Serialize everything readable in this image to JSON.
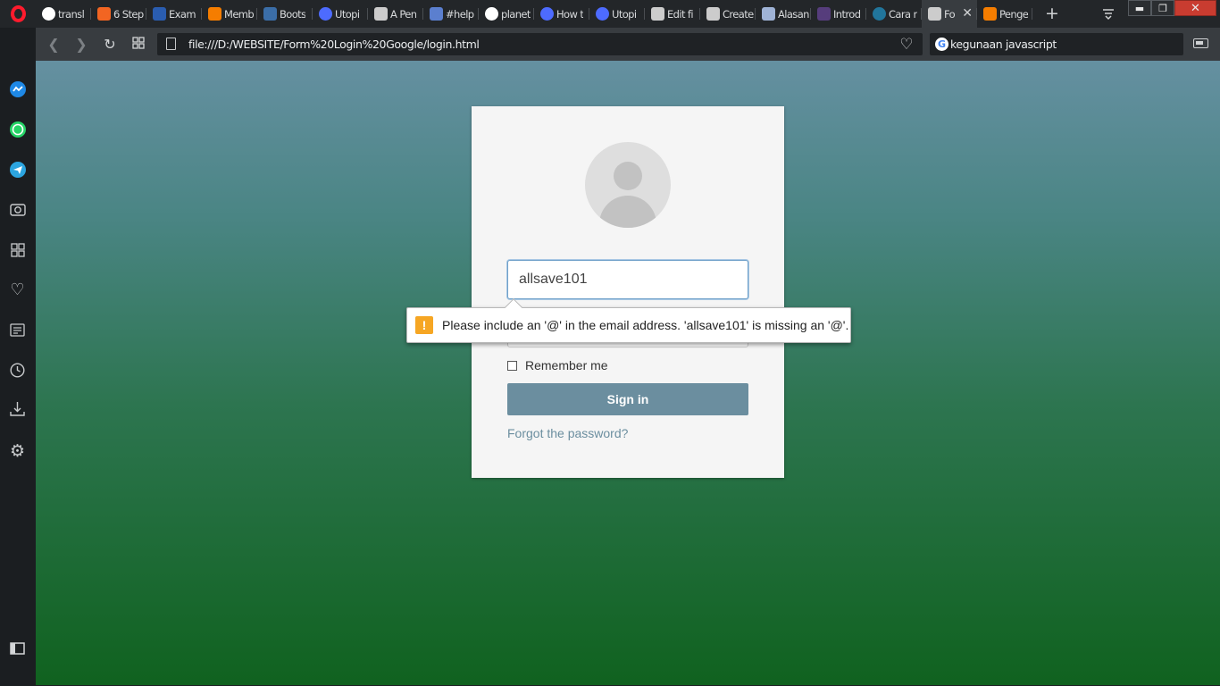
{
  "browser": {
    "tabs": [
      {
        "label": "transl",
        "icon": "google-icon",
        "color": "#ffffff"
      },
      {
        "label": "6 Step",
        "icon": "arrow-icon",
        "color": "#f26522"
      },
      {
        "label": "Exam",
        "icon": "chart-icon",
        "color": "#2a5db0"
      },
      {
        "label": "Memb",
        "icon": "blogger-icon",
        "color": "#f57d00"
      },
      {
        "label": "Boots",
        "icon": "bootstrap-icon",
        "color": "#3b6ea8"
      },
      {
        "label": "Utopi",
        "icon": "utopia-icon",
        "color": "#4d6bff"
      },
      {
        "label": "A Pen",
        "icon": "codepen-icon",
        "color": "#cccccc"
      },
      {
        "label": "#help",
        "icon": "slack-icon",
        "color": "#5b7fcf"
      },
      {
        "label": "planet",
        "icon": "github-icon",
        "color": "#ffffff"
      },
      {
        "label": "How t",
        "icon": "utopia-icon",
        "color": "#4d6bff"
      },
      {
        "label": "Utopi",
        "icon": "utopia-icon",
        "color": "#4d6bff"
      },
      {
        "label": "Edit fi",
        "icon": "file-icon",
        "color": "#cccccc"
      },
      {
        "label": "Create",
        "icon": "file-icon",
        "color": "#cccccc"
      },
      {
        "label": "Alasan",
        "icon": "hourglass-icon",
        "color": "#9fb3d6"
      },
      {
        "label": "Introd",
        "icon": "bootstrap-icon",
        "color": "#563d7c"
      },
      {
        "label": "Cara r",
        "icon": "wordpress-icon",
        "color": "#21759b"
      },
      {
        "label": "Fo",
        "icon": "file-icon",
        "color": "#cccccc",
        "active": true
      },
      {
        "label": "Penge",
        "icon": "blogger-icon",
        "color": "#f57d00"
      }
    ],
    "url": "file:///D:/WEBSITE/Form%20Login%20Google/login.html",
    "search_text": "kegunaan javascript"
  },
  "form": {
    "email_value": "allsave101",
    "remember_label": "Remember me",
    "signin_label": "Sign in",
    "forgot_label": "Forgot the password?"
  },
  "tooltip": {
    "warn_glyph": "!",
    "message": "Please include an '@' in the email address. 'allsave101' is missing an '@'."
  },
  "colors": {
    "accent": "#6b8e9f",
    "opera_red": "#ff1b2d",
    "warning": "#f6a623"
  }
}
